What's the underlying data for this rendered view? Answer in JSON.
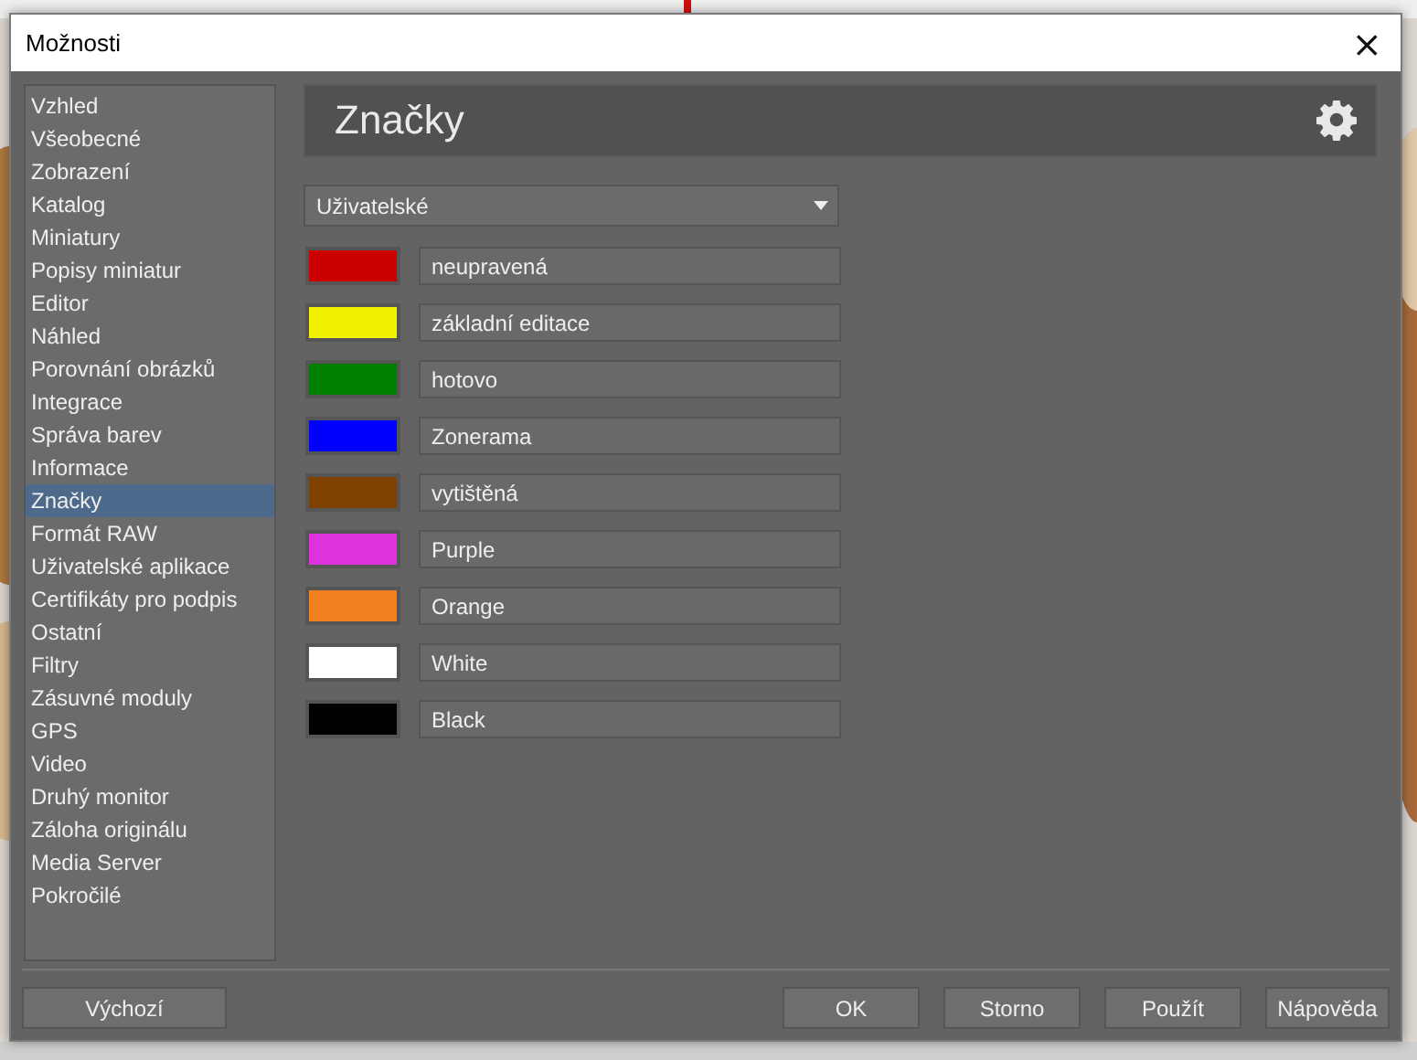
{
  "window": {
    "title": "Možnosti",
    "close": "×"
  },
  "sidebar": {
    "items": [
      {
        "label": "Vzhled",
        "selected": false
      },
      {
        "label": "Všeobecné",
        "selected": false
      },
      {
        "label": "Zobrazení",
        "selected": false
      },
      {
        "label": "Katalog",
        "selected": false
      },
      {
        "label": "Miniatury",
        "selected": false
      },
      {
        "label": "Popisy miniatur",
        "selected": false
      },
      {
        "label": "Editor",
        "selected": false
      },
      {
        "label": "Náhled",
        "selected": false
      },
      {
        "label": "Porovnání obrázků",
        "selected": false
      },
      {
        "label": "Integrace",
        "selected": false
      },
      {
        "label": "Správa barev",
        "selected": false
      },
      {
        "label": "Informace",
        "selected": false
      },
      {
        "label": "Značky",
        "selected": true
      },
      {
        "label": "Formát RAW",
        "selected": false
      },
      {
        "label": "Uživatelské aplikace",
        "selected": false
      },
      {
        "label": "Certifikáty pro podpis",
        "selected": false
      },
      {
        "label": "Ostatní",
        "selected": false
      },
      {
        "label": "Filtry",
        "selected": false
      },
      {
        "label": "Zásuvné moduly",
        "selected": false
      },
      {
        "label": "GPS",
        "selected": false
      },
      {
        "label": "Video",
        "selected": false
      },
      {
        "label": "Druhý monitor",
        "selected": false
      },
      {
        "label": "Záloha originálu",
        "selected": false
      },
      {
        "label": "Media Server",
        "selected": false
      },
      {
        "label": "Pokročilé",
        "selected": false
      }
    ]
  },
  "header": {
    "title": "Značky"
  },
  "preset": {
    "value": "Uživatelské"
  },
  "labels": [
    {
      "color": "#cc0000",
      "name": "neupravená"
    },
    {
      "color": "#f2f200",
      "name": "základní editace"
    },
    {
      "color": "#008000",
      "name": "hotovo"
    },
    {
      "color": "#0000ff",
      "name": "Zonerama"
    },
    {
      "color": "#804000",
      "name": "vytištěná"
    },
    {
      "color": "#dd33dd",
      "name": "Purple"
    },
    {
      "color": "#f08020",
      "name": "Orange"
    },
    {
      "color": "#ffffff",
      "name": "White"
    },
    {
      "color": "#000000",
      "name": "Black"
    }
  ],
  "buttons": {
    "left": [
      "Výchozí"
    ],
    "right": [
      "OK",
      "Storno",
      "Použít",
      "Nápověda"
    ]
  }
}
